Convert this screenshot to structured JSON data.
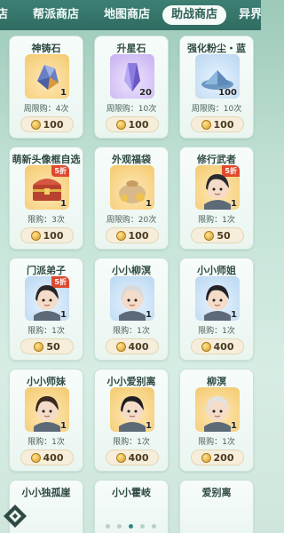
{
  "tabs": [
    {
      "label": "店",
      "active": false,
      "cut": true
    },
    {
      "label": "帮派商店",
      "active": false
    },
    {
      "label": "地图商店",
      "active": false
    },
    {
      "label": "助战商店",
      "active": true
    },
    {
      "label": "异界",
      "active": false
    }
  ],
  "items": [
    {
      "name": "神铸石",
      "qty": "1",
      "limit": "周限购：4次",
      "price": "100",
      "discount": "",
      "icon": "ore-icon",
      "bg": "gold"
    },
    {
      "name": "升星石",
      "qty": "20",
      "limit": "周限购：10次",
      "price": "100",
      "discount": "",
      "icon": "crystal-icon",
      "bg": "purple"
    },
    {
      "name": "强化粉尘・蓝",
      "qty": "100",
      "limit": "周限购：10次",
      "price": "100",
      "discount": "",
      "icon": "dust-icon",
      "bg": "blue"
    },
    {
      "name": "萌新头像框自选箱",
      "qty": "1",
      "limit": "限购：3次",
      "price": "100",
      "discount": "5折",
      "icon": "chest-icon",
      "bg": "gold"
    },
    {
      "name": "外观福袋",
      "qty": "1",
      "limit": "周限购：20次",
      "price": "100",
      "discount": "",
      "icon": "bag-icon",
      "bg": "gold"
    },
    {
      "name": "修行武者",
      "qty": "1",
      "limit": "限购：1次",
      "price": "50",
      "discount": "5折",
      "icon": "warrior-avatar-icon",
      "bg": "gold"
    },
    {
      "name": "门派弟子",
      "qty": "1",
      "limit": "限购：1次",
      "price": "50",
      "discount": "5折",
      "icon": "disciple-avatar-icon",
      "bg": "blue"
    },
    {
      "name": "小小柳溟",
      "qty": "1",
      "limit": "限购：1次",
      "price": "400",
      "discount": "",
      "icon": "liuming-avatar-icon",
      "bg": "blue"
    },
    {
      "name": "小小师姐",
      "qty": "1",
      "limit": "限购：1次",
      "price": "400",
      "discount": "",
      "icon": "senior-sister-avatar-icon",
      "bg": "blue"
    },
    {
      "name": "小小师妹",
      "qty": "1",
      "limit": "限购：1次",
      "price": "400",
      "discount": "",
      "icon": "junior-sister-avatar-icon",
      "bg": "gold"
    },
    {
      "name": "小小爱别离",
      "qty": "1",
      "limit": "限购：1次",
      "price": "400",
      "discount": "",
      "icon": "aibieli-avatar-icon",
      "bg": "gold"
    },
    {
      "name": "柳溟",
      "qty": "1",
      "limit": "限购：1次",
      "price": "200",
      "discount": "",
      "icon": "liuming-elder-avatar-icon",
      "bg": "gold"
    }
  ],
  "partial_items": [
    {
      "name": "小小独孤崖"
    },
    {
      "name": "小小霍岐"
    },
    {
      "name": "爱别离"
    }
  ],
  "pagination": {
    "count": 5,
    "active": 3
  }
}
